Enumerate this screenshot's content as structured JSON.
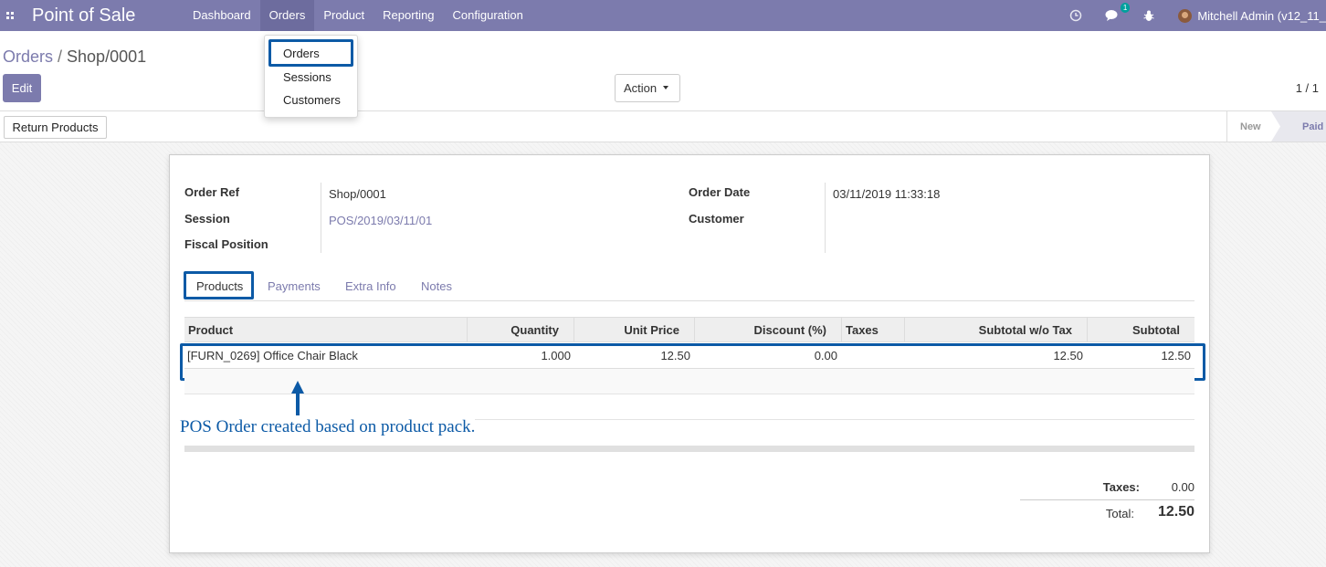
{
  "navbar": {
    "brand": "Point of Sale",
    "menus": [
      "Dashboard",
      "Orders",
      "Product",
      "Reporting",
      "Configuration"
    ],
    "active_menu": "Orders",
    "chat_badge": "1",
    "user": "Mitchell Admin (v12_11_",
    "color": "#7c7bad"
  },
  "dropdown": {
    "items": [
      "Orders",
      "Sessions",
      "Customers"
    ]
  },
  "breadcrumb": {
    "parent": "Orders",
    "current": "Shop/0001"
  },
  "control": {
    "edit_label": "Edit",
    "action_label": "Action",
    "pager": "1 / 1"
  },
  "statusbar": {
    "return_label": "Return Products",
    "stage_new": "New",
    "stage_paid": "Paid"
  },
  "form": {
    "order_ref_label": "Order Ref",
    "order_ref": "Shop/0001",
    "session_label": "Session",
    "session": "POS/2019/03/11/01",
    "fiscal_label": "Fiscal Position",
    "order_date_label": "Order Date",
    "order_date": "03/11/2019 11:33:18",
    "customer_label": "Customer"
  },
  "tabs": [
    "Products",
    "Payments",
    "Extra Info",
    "Notes"
  ],
  "table": {
    "headers": [
      "Product",
      "Quantity",
      "Unit Price",
      "Discount (%)",
      "Taxes",
      "Subtotal w/o Tax",
      "Subtotal"
    ],
    "rows": [
      {
        "product": "[FURN_0269] Office Chair Black",
        "quantity": "1.000",
        "unit_price": "12.50",
        "discount": "0.00",
        "taxes": "",
        "subtotal_wo_tax": "12.50",
        "subtotal": "12.50"
      }
    ]
  },
  "annotation": "POS Order created based on product pack.",
  "totals": {
    "taxes_label": "Taxes:",
    "taxes": "0.00",
    "total_label": "Total:",
    "total": "12.50"
  },
  "highlight_color": "#0c5aa6"
}
